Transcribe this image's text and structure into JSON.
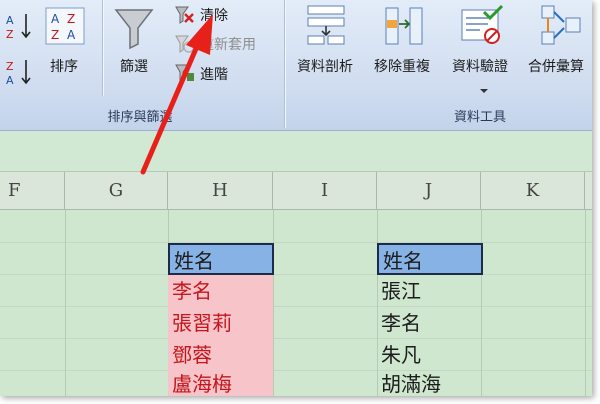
{
  "ribbon": {
    "sort_filter": {
      "sort_button": "排序",
      "filter_button": "篩選",
      "clear_button": "清除",
      "reapply_button": "重新套用",
      "advanced_button": "進階",
      "group_label": "排序與篩選"
    },
    "data_tools": {
      "text_to_columns": "資料剖析",
      "remove_duplicates": "移除重複",
      "data_validation": "資料驗證",
      "consolidate": "合併彙算",
      "group_label": "資料工具"
    }
  },
  "columns": [
    "F",
    "G",
    "H",
    "I",
    "J",
    "K"
  ],
  "table_h": {
    "header": "姓名",
    "rows": [
      "李名",
      "張習莉",
      "鄧蓉",
      "盧海梅"
    ]
  },
  "table_j": {
    "header": "姓名",
    "rows": [
      "張江",
      "李名",
      "朱凡",
      "胡滿海"
    ]
  },
  "colors": {
    "duplicate_fill": "#f7c4c9",
    "duplicate_text": "#c4161c",
    "header_fill": "#87b2e6",
    "annotation_arrow": "#e8201a"
  }
}
